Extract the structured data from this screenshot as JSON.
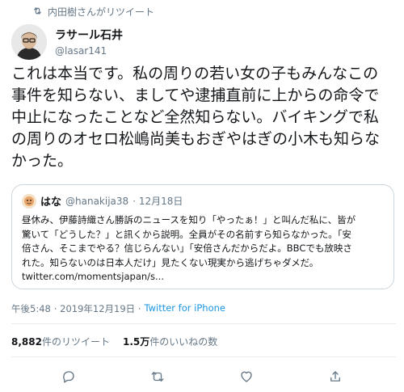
{
  "retweet_banner": {
    "text": "内田樹さんがリツイート"
  },
  "author": {
    "name": "ラサール石井",
    "handle": "@lasar141"
  },
  "tweet": {
    "lines": [
      "これは本当です。私の周りの若い女の子もみんなこの",
      "事件を知らない、ましてや逮捕直前に上からの命令で",
      "中止になったことなど全然知らない。バイキングで私",
      "の周りのオセロ松嶋尚美もおぎやはぎの小木も知らな",
      "かった。"
    ]
  },
  "quote": {
    "name": "はな",
    "handle": "@hanakija38",
    "date": "· 12月18日",
    "lines": [
      "昼休み、伊藤詩織さん勝訴のニュースを知り「やったぁ！」と叫んだ私に、皆が",
      "驚いて「どうした？」と訊くから説明。全員がその名前すら知らなかった。「安",
      "倍さん、そこまでやる？信じらんない」「安倍さんだからだよ。BBCでも放映さ",
      "れた。知らないのは日本人だけ」見たくない現実から逃げちゃダメだ。"
    ],
    "link": "twitter.com/momentsjapan/s..."
  },
  "meta": {
    "time": "午後5:48",
    "date": "· 2019年12月19日 ·",
    "app": "Twitter for iPhone"
  },
  "stats": {
    "retweets_count": "8,882",
    "retweets_label": "件のリツイート",
    "likes_count": "1.5万",
    "likes_label": "件のいいねの数"
  },
  "icons": [
    "retweet-icon",
    "reply-icon",
    "retweet-action-icon",
    "like-icon",
    "share-icon"
  ],
  "colors": {
    "link": "#1b95e0",
    "muted": "#657786",
    "border": "#ccd6dd"
  }
}
